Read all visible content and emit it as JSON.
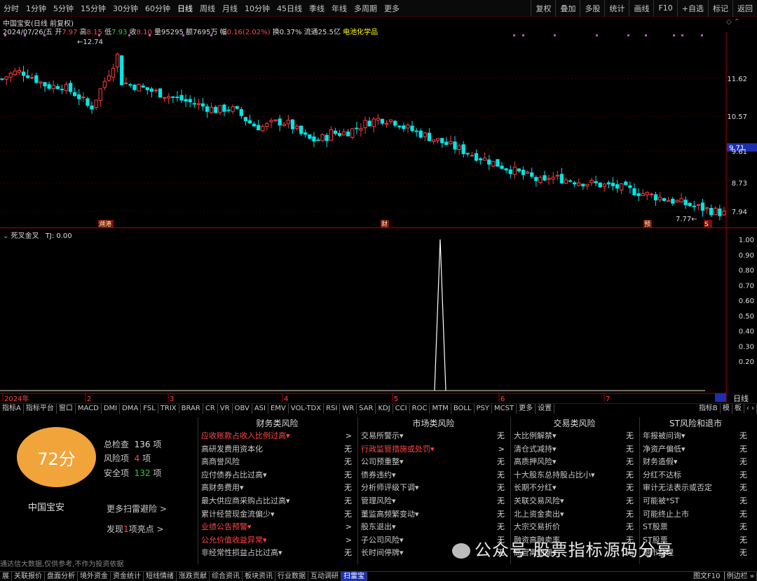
{
  "topbar": {
    "periods": [
      "分时",
      "1分钟",
      "5分钟",
      "15分钟",
      "30分钟",
      "60分钟",
      "日线",
      "周线",
      "月线",
      "10分钟",
      "45日线",
      "季线",
      "年线",
      "多周期",
      "更多"
    ],
    "right": [
      "复权",
      "叠加",
      "多股",
      "统计",
      "画线",
      "F10",
      "+自选",
      "标记",
      "返回"
    ]
  },
  "header": {
    "title": "中国宝安(日线 前复权)",
    "date": "2024/07/26/五",
    "open_label": "开",
    "open": "7.97",
    "high_label": "高",
    "high": "8.15",
    "low_label": "低",
    "low": "7.93",
    "close_label": "收",
    "close": "8.10",
    "vol_label": "量",
    "vol": "95295",
    "amt_label": "额",
    "amt": "7695万",
    "chg_label": "幅",
    "chg": "0.16(2.02%)",
    "turn_label": "换",
    "turn": "0.37%",
    "float_label": "流通",
    "float": "25.5亿",
    "concept": "电池化学品"
  },
  "price_axis": [
    "11.62",
    "10.57",
    "9.71",
    "9.61",
    "8.73",
    "7.94"
  ],
  "price_marks": {
    "high": "12.74",
    "low": "7.77"
  },
  "event_tags": [
    "溯港",
    "财",
    "预",
    "S"
  ],
  "indicator": {
    "name": "死叉金叉",
    "tj": "TJ: 0.00",
    "axis": [
      "1.00",
      "0.90",
      "0.80",
      "0.70",
      "0.60",
      "0.50",
      "0.40",
      "0.30",
      "0.20"
    ],
    "x_labels": [
      "2024年",
      "2",
      "3",
      "4",
      "5",
      "6",
      "7"
    ],
    "right_label": "日线"
  },
  "indicator_tabs": [
    "指标A",
    "指标平台",
    "窗口",
    "MACD",
    "DMI",
    "DMA",
    "FSL",
    "TRIX",
    "BRAR",
    "CR",
    "VR",
    "OBV",
    "ASI",
    "EMV",
    "VOL-TDX",
    "RSI",
    "WR",
    "SAR",
    "KDJ",
    "CCI",
    "ROC",
    "MTM",
    "BOLL",
    "PSY",
    "MCST",
    "更多",
    "设置"
  ],
  "indicator_tabs_right": [
    "指标B",
    "模",
    "板"
  ],
  "risk": {
    "score": "72分",
    "stock": "中国宝安",
    "total_label": "总检查",
    "total": "136",
    "total_unit": "项",
    "risk_label": "风险项",
    "risk": "4",
    "risk_unit": "项",
    "safe_label": "安全项",
    "safe": "132",
    "safe_unit": "项",
    "more_scan": "更多扫雷避险 >",
    "highlight_pre": "发现",
    "highlight_num": "1",
    "highlight_post": "项亮点 >",
    "disclaimer": "通达信大数据,仅供参考,不作为投资依据",
    "columns": [
      {
        "title": "财务类风险",
        "rows": [
          [
            "应收账款占收入比例过高▾",
            ">",
            1
          ],
          [
            "高研发费用资本化",
            "无",
            0
          ],
          [
            "高商誉风险",
            "无",
            0
          ],
          [
            "应付债券占比过高▾",
            "无",
            0
          ],
          [
            "高财务费用▾",
            "无",
            0
          ],
          [
            "最大供应商采购占比过高▾",
            "无",
            0
          ],
          [
            "累计经营现金流偏少▾",
            "无",
            0
          ],
          [
            "业绩公告预警▾",
            ">",
            1
          ],
          [
            "公允价值收益异常▾",
            ">",
            1
          ],
          [
            "非经常性损益占比过高▾",
            "无",
            0
          ]
        ]
      },
      {
        "title": "市场类风险",
        "rows": [
          [
            "交易所警示▾",
            "无",
            0
          ],
          [
            "行政监管措施或处罚▾",
            ">",
            1
          ],
          [
            "公司预重整▾",
            "无",
            0
          ],
          [
            "债券违约▾",
            "无",
            0
          ],
          [
            "分析师评级下调▾",
            "无",
            0
          ],
          [
            "管理风险▾",
            "无",
            0
          ],
          [
            "董监高频繁变动▾",
            "无",
            0
          ],
          [
            "股东退出▾",
            "无",
            0
          ],
          [
            "子公司风险▾",
            "无",
            0
          ],
          [
            "长时间停牌▾",
            "无",
            0
          ]
        ]
      },
      {
        "title": "交易类风险",
        "rows": [
          [
            "大比例解禁▾",
            "无",
            0
          ],
          [
            "清仓式减持▾",
            "无",
            0
          ],
          [
            "高质押风险▾",
            "无",
            0
          ],
          [
            "十大股东总持股占比小▾",
            "无",
            0
          ],
          [
            "长期不分红▾",
            "无",
            0
          ],
          [
            "关联交易风险▾",
            "无",
            0
          ],
          [
            "北上资金卖出▾",
            "无",
            0
          ],
          [
            "大宗交易折价",
            "无",
            0
          ],
          [
            "融资高融卖率",
            "无",
            0
          ],
          [
            "高管离职潮▾",
            "无",
            0
          ]
        ]
      },
      {
        "title": "ST风险和退市",
        "rows": [
          [
            "年报被问询▾",
            "无",
            0
          ],
          [
            "净资产偏低▾",
            "无",
            0
          ],
          [
            "财务造假▾",
            "无",
            0
          ],
          [
            "分红不达标",
            "无",
            0
          ],
          [
            "审计无法表示或否定",
            "无",
            0
          ],
          [
            "可能被*ST",
            "无",
            0
          ],
          [
            "可能终止上市",
            "无",
            0
          ],
          [
            "ST股票",
            "无",
            0
          ],
          [
            "ST股票",
            "无",
            0
          ],
          [
            "退市整理",
            "无",
            0
          ]
        ]
      }
    ]
  },
  "bottombar": [
    "展",
    "关联报价",
    "盘面分析",
    "境外资金",
    "资金统计",
    "短线情绪",
    "涨跌贡献",
    "综合资讯",
    "板块资讯",
    "行业数据",
    "互动调研",
    "扫雷宝"
  ],
  "bottom_right": "图文F10 │例边栏 »",
  "watermark": "公众号·股票指标源码分享",
  "colors": {
    "up": "#ff3c3c",
    "down": "#00e6e6",
    "axis": "#aa0000",
    "score": "#f0a43a"
  }
}
